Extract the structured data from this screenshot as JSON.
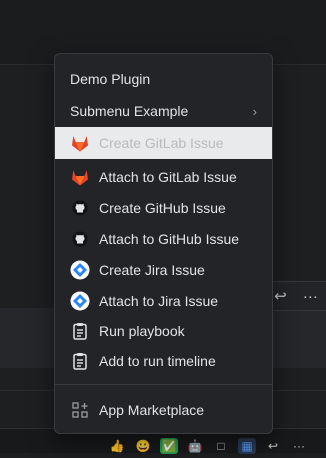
{
  "menu": {
    "items": [
      {
        "label": "Demo Plugin",
        "icon": "none"
      },
      {
        "label": "Submenu Example",
        "icon": "chevron-right",
        "has_submenu": true
      },
      {
        "label": "Create GitLab Issue",
        "icon": "gitlab-icon",
        "highlighted": true
      },
      {
        "label": "Attach to GitLab Issue",
        "icon": "gitlab-icon"
      },
      {
        "label": "Create GitHub Issue",
        "icon": "github-icon"
      },
      {
        "label": "Attach to GitHub Issue",
        "icon": "github-icon"
      },
      {
        "label": "Create Jira Issue",
        "icon": "jira-icon"
      },
      {
        "label": "Attach to Jira Issue",
        "icon": "jira-icon"
      },
      {
        "label": "Run playbook",
        "icon": "clipboard-icon"
      },
      {
        "label": "Add to run timeline",
        "icon": "clipboard-icon"
      },
      {
        "label": "App Marketplace",
        "icon": "marketplace-icon"
      }
    ],
    "submenu_glyph": "›"
  },
  "post_actions": {
    "reply_glyph": "↩",
    "more_glyph": "···"
  },
  "reactions": {
    "items": [
      "👍",
      "😀",
      "✅",
      "🤖",
      "□",
      "▦",
      "↩",
      "···"
    ]
  },
  "colors": {
    "menu_bg": "#232427",
    "highlight_bg": "#e9eaec",
    "gitlab_orange": "#e24329",
    "jira_blue": "#2684ff",
    "text": "#e2e3e5"
  }
}
